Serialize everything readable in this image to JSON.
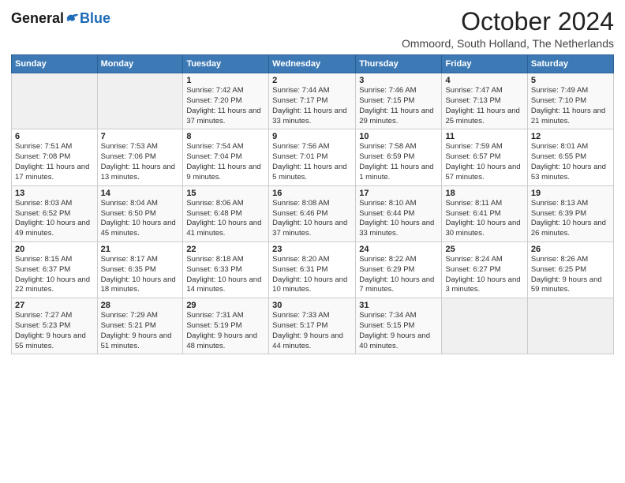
{
  "header": {
    "logo": {
      "general": "General",
      "blue": "Blue",
      "tagline": ""
    },
    "title": "October 2024",
    "subtitle": "Ommoord, South Holland, The Netherlands"
  },
  "weekdays": [
    "Sunday",
    "Monday",
    "Tuesday",
    "Wednesday",
    "Thursday",
    "Friday",
    "Saturday"
  ],
  "weeks": [
    [
      {
        "day": "",
        "sunrise": "",
        "sunset": "",
        "daylight": ""
      },
      {
        "day": "",
        "sunrise": "",
        "sunset": "",
        "daylight": ""
      },
      {
        "day": "1",
        "sunrise": "Sunrise: 7:42 AM",
        "sunset": "Sunset: 7:20 PM",
        "daylight": "Daylight: 11 hours and 37 minutes."
      },
      {
        "day": "2",
        "sunrise": "Sunrise: 7:44 AM",
        "sunset": "Sunset: 7:17 PM",
        "daylight": "Daylight: 11 hours and 33 minutes."
      },
      {
        "day": "3",
        "sunrise": "Sunrise: 7:46 AM",
        "sunset": "Sunset: 7:15 PM",
        "daylight": "Daylight: 11 hours and 29 minutes."
      },
      {
        "day": "4",
        "sunrise": "Sunrise: 7:47 AM",
        "sunset": "Sunset: 7:13 PM",
        "daylight": "Daylight: 11 hours and 25 minutes."
      },
      {
        "day": "5",
        "sunrise": "Sunrise: 7:49 AM",
        "sunset": "Sunset: 7:10 PM",
        "daylight": "Daylight: 11 hours and 21 minutes."
      }
    ],
    [
      {
        "day": "6",
        "sunrise": "Sunrise: 7:51 AM",
        "sunset": "Sunset: 7:08 PM",
        "daylight": "Daylight: 11 hours and 17 minutes."
      },
      {
        "day": "7",
        "sunrise": "Sunrise: 7:53 AM",
        "sunset": "Sunset: 7:06 PM",
        "daylight": "Daylight: 11 hours and 13 minutes."
      },
      {
        "day": "8",
        "sunrise": "Sunrise: 7:54 AM",
        "sunset": "Sunset: 7:04 PM",
        "daylight": "Daylight: 11 hours and 9 minutes."
      },
      {
        "day": "9",
        "sunrise": "Sunrise: 7:56 AM",
        "sunset": "Sunset: 7:01 PM",
        "daylight": "Daylight: 11 hours and 5 minutes."
      },
      {
        "day": "10",
        "sunrise": "Sunrise: 7:58 AM",
        "sunset": "Sunset: 6:59 PM",
        "daylight": "Daylight: 11 hours and 1 minute."
      },
      {
        "day": "11",
        "sunrise": "Sunrise: 7:59 AM",
        "sunset": "Sunset: 6:57 PM",
        "daylight": "Daylight: 10 hours and 57 minutes."
      },
      {
        "day": "12",
        "sunrise": "Sunrise: 8:01 AM",
        "sunset": "Sunset: 6:55 PM",
        "daylight": "Daylight: 10 hours and 53 minutes."
      }
    ],
    [
      {
        "day": "13",
        "sunrise": "Sunrise: 8:03 AM",
        "sunset": "Sunset: 6:52 PM",
        "daylight": "Daylight: 10 hours and 49 minutes."
      },
      {
        "day": "14",
        "sunrise": "Sunrise: 8:04 AM",
        "sunset": "Sunset: 6:50 PM",
        "daylight": "Daylight: 10 hours and 45 minutes."
      },
      {
        "day": "15",
        "sunrise": "Sunrise: 8:06 AM",
        "sunset": "Sunset: 6:48 PM",
        "daylight": "Daylight: 10 hours and 41 minutes."
      },
      {
        "day": "16",
        "sunrise": "Sunrise: 8:08 AM",
        "sunset": "Sunset: 6:46 PM",
        "daylight": "Daylight: 10 hours and 37 minutes."
      },
      {
        "day": "17",
        "sunrise": "Sunrise: 8:10 AM",
        "sunset": "Sunset: 6:44 PM",
        "daylight": "Daylight: 10 hours and 33 minutes."
      },
      {
        "day": "18",
        "sunrise": "Sunrise: 8:11 AM",
        "sunset": "Sunset: 6:41 PM",
        "daylight": "Daylight: 10 hours and 30 minutes."
      },
      {
        "day": "19",
        "sunrise": "Sunrise: 8:13 AM",
        "sunset": "Sunset: 6:39 PM",
        "daylight": "Daylight: 10 hours and 26 minutes."
      }
    ],
    [
      {
        "day": "20",
        "sunrise": "Sunrise: 8:15 AM",
        "sunset": "Sunset: 6:37 PM",
        "daylight": "Daylight: 10 hours and 22 minutes."
      },
      {
        "day": "21",
        "sunrise": "Sunrise: 8:17 AM",
        "sunset": "Sunset: 6:35 PM",
        "daylight": "Daylight: 10 hours and 18 minutes."
      },
      {
        "day": "22",
        "sunrise": "Sunrise: 8:18 AM",
        "sunset": "Sunset: 6:33 PM",
        "daylight": "Daylight: 10 hours and 14 minutes."
      },
      {
        "day": "23",
        "sunrise": "Sunrise: 8:20 AM",
        "sunset": "Sunset: 6:31 PM",
        "daylight": "Daylight: 10 hours and 10 minutes."
      },
      {
        "day": "24",
        "sunrise": "Sunrise: 8:22 AM",
        "sunset": "Sunset: 6:29 PM",
        "daylight": "Daylight: 10 hours and 7 minutes."
      },
      {
        "day": "25",
        "sunrise": "Sunrise: 8:24 AM",
        "sunset": "Sunset: 6:27 PM",
        "daylight": "Daylight: 10 hours and 3 minutes."
      },
      {
        "day": "26",
        "sunrise": "Sunrise: 8:26 AM",
        "sunset": "Sunset: 6:25 PM",
        "daylight": "Daylight: 9 hours and 59 minutes."
      }
    ],
    [
      {
        "day": "27",
        "sunrise": "Sunrise: 7:27 AM",
        "sunset": "Sunset: 5:23 PM",
        "daylight": "Daylight: 9 hours and 55 minutes."
      },
      {
        "day": "28",
        "sunrise": "Sunrise: 7:29 AM",
        "sunset": "Sunset: 5:21 PM",
        "daylight": "Daylight: 9 hours and 51 minutes."
      },
      {
        "day": "29",
        "sunrise": "Sunrise: 7:31 AM",
        "sunset": "Sunset: 5:19 PM",
        "daylight": "Daylight: 9 hours and 48 minutes."
      },
      {
        "day": "30",
        "sunrise": "Sunrise: 7:33 AM",
        "sunset": "Sunset: 5:17 PM",
        "daylight": "Daylight: 9 hours and 44 minutes."
      },
      {
        "day": "31",
        "sunrise": "Sunrise: 7:34 AM",
        "sunset": "Sunset: 5:15 PM",
        "daylight": "Daylight: 9 hours and 40 minutes."
      },
      {
        "day": "",
        "sunrise": "",
        "sunset": "",
        "daylight": ""
      },
      {
        "day": "",
        "sunrise": "",
        "sunset": "",
        "daylight": ""
      }
    ]
  ]
}
